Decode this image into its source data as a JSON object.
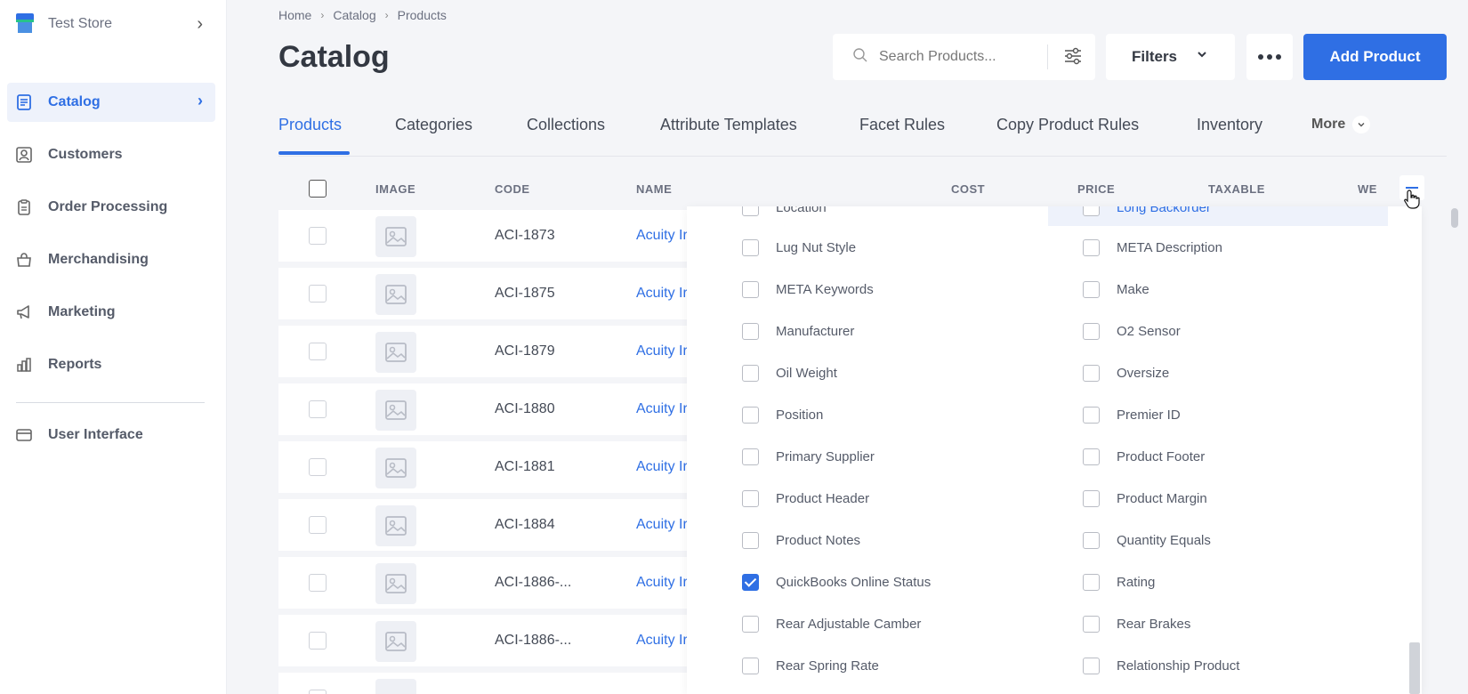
{
  "sidebar": {
    "store_name": "Test Store",
    "items": [
      {
        "label": "Catalog",
        "icon": "catalog-icon",
        "active": true
      },
      {
        "label": "Customers",
        "icon": "customers-icon"
      },
      {
        "label": "Order Processing",
        "icon": "order-processing-icon"
      },
      {
        "label": "Merchandising",
        "icon": "merchandising-icon"
      },
      {
        "label": "Marketing",
        "icon": "megaphone-icon"
      },
      {
        "label": "Reports",
        "icon": "reports-icon"
      }
    ],
    "footer_item": {
      "label": "User Interface",
      "icon": "window-icon"
    }
  },
  "breadcrumb": [
    "Home",
    "Catalog",
    "Products"
  ],
  "page_title": "Catalog",
  "search": {
    "placeholder": "Search Products..."
  },
  "toolbar": {
    "filters_label": "Filters",
    "add_label": "Add Product"
  },
  "tabs": [
    "Products",
    "Categories",
    "Collections",
    "Attribute Templates",
    "Facet Rules",
    "Copy Product Rules",
    "Inventory"
  ],
  "tabs_more": "More",
  "table": {
    "columns": [
      "IMAGE",
      "CODE",
      "NAME",
      "COST",
      "PRICE",
      "TAXABLE",
      "WE"
    ],
    "rows": [
      {
        "code": "ACI-1873",
        "name": "Acuity Ir"
      },
      {
        "code": "ACI-1875",
        "name": "Acuity Ir"
      },
      {
        "code": "ACI-1879",
        "name": "Acuity Ir"
      },
      {
        "code": "ACI-1880",
        "name": "Acuity Ir"
      },
      {
        "code": "ACI-1881",
        "name": "Acuity Ir"
      },
      {
        "code": "ACI-1884",
        "name": "Acuity Ir"
      },
      {
        "code": "ACI-1886-...",
        "name": "Acuity Ir"
      },
      {
        "code": "ACI-1886-...",
        "name": "Acuity Ir"
      }
    ]
  },
  "column_chooser": {
    "left": [
      {
        "label": "Location",
        "checked": false
      },
      {
        "label": "Lug Nut Style",
        "checked": false
      },
      {
        "label": "META Keywords",
        "checked": false
      },
      {
        "label": "Manufacturer",
        "checked": false
      },
      {
        "label": "Oil Weight",
        "checked": false
      },
      {
        "label": "Position",
        "checked": false
      },
      {
        "label": "Primary Supplier",
        "checked": false
      },
      {
        "label": "Product Header",
        "checked": false
      },
      {
        "label": "Product Notes",
        "checked": false
      },
      {
        "label": "QuickBooks Online Status",
        "checked": true
      },
      {
        "label": "Rear Adjustable Camber",
        "checked": false
      },
      {
        "label": "Rear Spring Rate",
        "checked": false
      }
    ],
    "right": [
      {
        "label": "Long Backorder",
        "checked": false
      },
      {
        "label": "META Description",
        "checked": false
      },
      {
        "label": "Make",
        "checked": false
      },
      {
        "label": "O2 Sensor",
        "checked": false
      },
      {
        "label": "Oversize",
        "checked": false
      },
      {
        "label": "Premier ID",
        "checked": false
      },
      {
        "label": "Product Footer",
        "checked": false
      },
      {
        "label": "Product Margin",
        "checked": false
      },
      {
        "label": "Quantity Equals",
        "checked": false
      },
      {
        "label": "Rating",
        "checked": false
      },
      {
        "label": "Rear Brakes",
        "checked": false
      },
      {
        "label": "Relationship Product",
        "checked": false
      }
    ]
  },
  "colors": {
    "accent": "#2f6fe4",
    "background": "#f4f5f8"
  }
}
